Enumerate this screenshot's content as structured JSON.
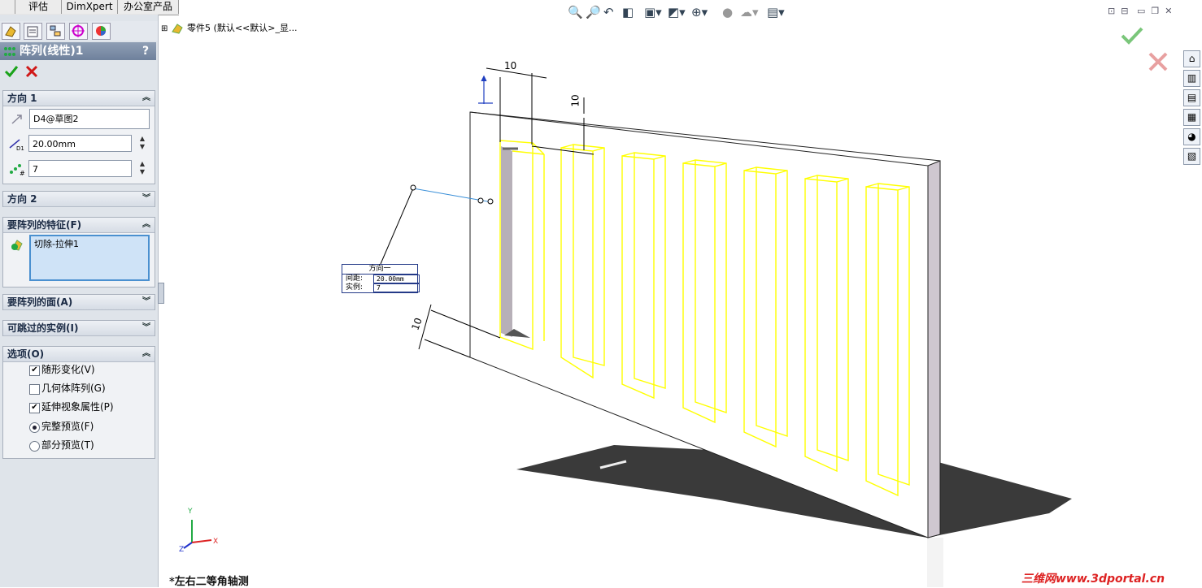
{
  "tabs": [
    "评估",
    "DimXpert",
    "办公室产品"
  ],
  "panel": {
    "title": "阵列(线性)1",
    "help": "?",
    "ok_icon": "check-icon",
    "cancel_icon": "x-icon",
    "direction1": {
      "header": "方向 1",
      "edge": "D4@草图2",
      "spacing": "20.00mm",
      "count": "7"
    },
    "direction2": {
      "header": "方向 2"
    },
    "features": {
      "header": "要阵列的特征(F)",
      "item": "切除-拉伸1"
    },
    "faces": {
      "header": "要阵列的面(A)"
    },
    "skip": {
      "header": "可跳过的实例(I)"
    },
    "options": {
      "header": "选项(O)",
      "items": [
        {
          "label": "随形变化(V)",
          "type": "checkbox",
          "checked": true
        },
        {
          "label": "几何体阵列(G)",
          "type": "checkbox",
          "checked": false
        },
        {
          "label": "延伸视象属性(P)",
          "type": "checkbox",
          "checked": true
        },
        {
          "label": "完整预览(F)",
          "type": "radio",
          "checked": true
        },
        {
          "label": "部分预览(T)",
          "type": "radio",
          "checked": false
        }
      ]
    }
  },
  "tree": {
    "label": "零件5 (默认<<默认>_显..."
  },
  "callout": {
    "title": "方向一",
    "spacing_label": "间距:",
    "spacing_value": "20.00mm",
    "count_label": "实例:",
    "count_value": "7"
  },
  "dims": {
    "d1": "10",
    "d2": "10",
    "d3": "10"
  },
  "triad": {
    "x": "X",
    "y": "Y",
    "z": "Z"
  },
  "view_label": "*左右二等角轴测",
  "watermark": "三维网www.3dportal.cn",
  "colors": {
    "preview": "#ffff00",
    "accent_ok": "#1aa31a",
    "accent_cancel": "#d01818"
  }
}
